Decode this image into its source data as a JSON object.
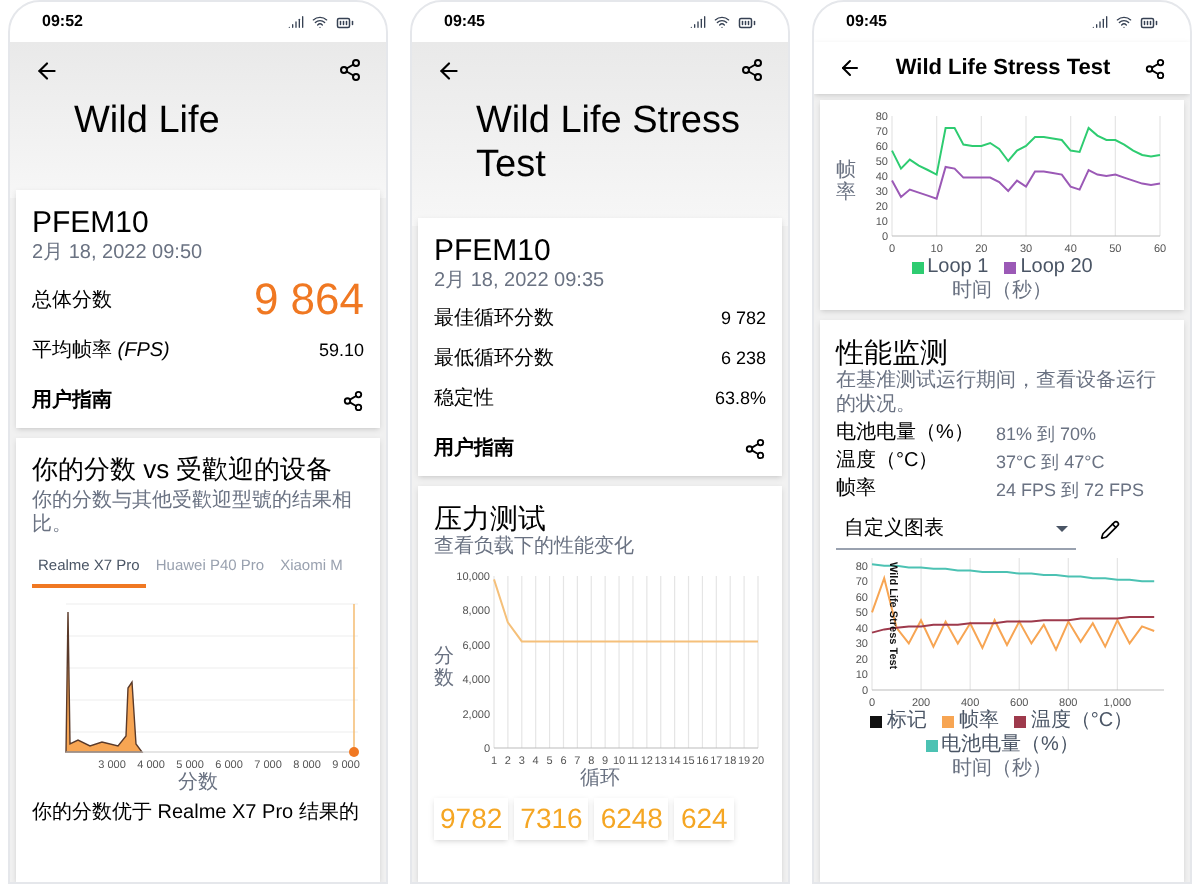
{
  "screen_1": {
    "status_bar": {
      "time": "09:52"
    },
    "header": {
      "title": "Wild Life"
    },
    "result_card": {
      "device": "PFEM10",
      "date": "2月 18, 2022 09:50",
      "score_label": "总体分数",
      "score_value": "9 864",
      "rows": [
        {
          "label": "平均帧率 *(FPS)*",
          "value": "59.10"
        }
      ],
      "guide_link": "用户指南"
    },
    "comparison_card": {
      "title": "你的分数 vs 受歡迎的设备",
      "subtitle": "你的分数与其他受歡迎型號的结果相比。",
      "tabs": [
        {
          "label": "Realme X7 Pro",
          "selected": true
        },
        {
          "label": "Huawei P40 Pro",
          "selected": false
        },
        {
          "label": "Xiaomi M",
          "selected": false
        }
      ],
      "histogram": {
        "x_tick_labels": [
          "3 000",
          "4 000",
          "5 000",
          "6 000",
          "7 000",
          "8 000",
          "9 000"
        ],
        "xlabel": "分数"
      },
      "footer_text": "你的分数优于 Realme X7 Pro 结果的"
    }
  },
  "screen_2": {
    "status_bar": {
      "time": "09:45"
    },
    "header": {
      "title": "Wild Life Stress Test"
    },
    "result_card": {
      "device": "PFEM10",
      "date": "2月 18, 2022 09:35",
      "rows": [
        {
          "label": "最佳循环分数",
          "value": "9 782"
        },
        {
          "label": "最低循环分数",
          "value": "6 238"
        },
        {
          "label": "稳定性",
          "value": "63.8%"
        }
      ],
      "guide_link": "用户指南"
    },
    "stress_card": {
      "title": "压力测试",
      "subtitle": "查看负载下的性能变化",
      "chart_data": {
        "type": "line",
        "xlabel": "循环",
        "ylabel": "分数",
        "x": [
          1,
          2,
          3,
          4,
          5,
          6,
          7,
          8,
          9,
          10,
          11,
          12,
          13,
          14,
          15,
          16,
          17,
          18,
          19,
          20
        ],
        "series": [
          {
            "color": "#f5c07a",
            "values": [
              9800,
              7300,
              6200,
              6200,
              6200,
              6200,
              6200,
              6200,
              6200,
              6200,
              6200,
              6200,
              6200,
              6200,
              6200,
              6200,
              6200,
              6200,
              6200,
              6200
            ]
          }
        ],
        "grid": true,
        "xlim": [
          1,
          20
        ],
        "ylim": [
          0,
          10000
        ],
        "xticks": [
          1,
          2,
          3,
          4,
          5,
          6,
          7,
          8,
          9,
          10,
          11,
          12,
          13,
          14,
          15,
          16,
          17,
          18,
          19,
          20
        ],
        "yticks": [
          {
            "value": 0,
            "label": "0"
          },
          {
            "value": 2000,
            "label": "2,000"
          },
          {
            "value": 4000,
            "label": "4,000"
          },
          {
            "value": 6000,
            "label": "6,000"
          },
          {
            "value": 8000,
            "label": "8,000"
          },
          {
            "value": 10000,
            "label": "10,000"
          }
        ]
      },
      "score_tiles": [
        "9782",
        "7316",
        "6248",
        "624"
      ]
    }
  },
  "screen_3": {
    "status_bar": {
      "time": "09:45"
    },
    "app_bar": {
      "title": "Wild Life Stress Test"
    },
    "fps_card": {
      "chart_data": {
        "type": "line",
        "xlabel": "时间（秒）",
        "ylabel": "帧率",
        "x": [
          0,
          2,
          4,
          6,
          8,
          10,
          12,
          14,
          16,
          18,
          20,
          22,
          24,
          26,
          28,
          30,
          32,
          34,
          36,
          38,
          40,
          42,
          44,
          46,
          48,
          50,
          52,
          54,
          56,
          58,
          60
        ],
        "series": [
          {
            "name": "Loop 1",
            "color": "#2ecc71",
            "values": [
              57,
              45,
              51,
              47,
              44,
              41,
              72,
              72,
              61,
              60,
              60,
              62,
              58,
              50,
              57,
              60,
              66,
              66,
              65,
              64,
              57,
              56,
              72,
              67,
              64,
              64,
              61,
              57,
              54,
              53,
              54
            ]
          },
          {
            "name": "Loop 20",
            "color": "#9b59b6",
            "values": [
              37,
              26,
              31,
              29,
              27,
              25,
              46,
              45,
              39,
              39,
              39,
              39,
              36,
              30,
              37,
              33,
              43,
              43,
              42,
              41,
              33,
              31,
              44,
              41,
              40,
              41,
              39,
              37,
              35,
              34,
              35
            ]
          }
        ],
        "grid": true,
        "xlim": [
          0,
          60
        ],
        "ylim": [
          0,
          80
        ],
        "xticks": [
          0,
          10,
          20,
          30,
          40,
          50,
          60
        ],
        "yticks": [
          0,
          10,
          20,
          30,
          40,
          50,
          60,
          70,
          80
        ]
      }
    },
    "monitor_card": {
      "title": "性能监测",
      "subtitle": "在基准测试运行期间，查看设备运行的状况。",
      "rows": [
        {
          "label": "电池电量（%）",
          "value": "81% 到 70%"
        },
        {
          "label": "温度（°C）",
          "value": "37°C 到 47°C"
        },
        {
          "label": "帧率",
          "value": "24 FPS 到 72 FPS"
        }
      ],
      "dropdown": {
        "value": "自定义图表"
      },
      "chart_data": {
        "type": "line",
        "xlabel": "时间（秒）",
        "x": [
          0,
          50,
          100,
          150,
          200,
          250,
          300,
          350,
          400,
          450,
          500,
          550,
          600,
          650,
          700,
          750,
          800,
          850,
          900,
          950,
          1000,
          1050,
          1100,
          1150
        ],
        "series": [
          {
            "name": "标记",
            "color": "#111111",
            "values": [
              null,
              null,
              null,
              null,
              null,
              null,
              null,
              null,
              null,
              null,
              null,
              null,
              null,
              null,
              null,
              null,
              null,
              null,
              null,
              null,
              null,
              null,
              null,
              null
            ]
          },
          {
            "name": "帧率",
            "color": "#f7a553",
            "values": [
              50,
              72,
              40,
              30,
              45,
              28,
              44,
              30,
              43,
              27,
              45,
              29,
              44,
              30,
              42,
              26,
              44,
              31,
              43,
              28,
              45,
              30,
              41,
              38
            ]
          },
          {
            "name": "温度（°C）",
            "color": "#9e3a4c",
            "values": [
              37,
              39,
              40,
              41,
              41,
              42,
              42,
              42,
              43,
              43,
              43,
              44,
              44,
              44,
              45,
              45,
              45,
              46,
              46,
              46,
              46,
              47,
              47,
              47
            ]
          },
          {
            "name": "电池电量（%）",
            "color": "#4cc2b3",
            "values": [
              81,
              80,
              80,
              79,
              79,
              78,
              78,
              77,
              77,
              76,
              76,
              76,
              75,
              75,
              74,
              74,
              73,
              73,
              72,
              72,
              71,
              71,
              70,
              70
            ]
          }
        ],
        "grid": true,
        "xlim": [
          0,
          1190
        ],
        "ylim": [
          0,
          85
        ],
        "xticks": [
          {
            "value": 0,
            "label": "0"
          },
          {
            "value": 200,
            "label": "200"
          },
          {
            "value": 400,
            "label": "400"
          },
          {
            "value": 600,
            "label": "600"
          },
          {
            "value": 800,
            "label": "800"
          },
          {
            "value": 1000,
            "label": "1,000"
          }
        ],
        "yticks": [
          0,
          10,
          20,
          30,
          40,
          50,
          60,
          70,
          80
        ],
        "annotations": [
          {
            "x": 0,
            "text": "Wild Life Stress Test"
          }
        ]
      }
    }
  }
}
